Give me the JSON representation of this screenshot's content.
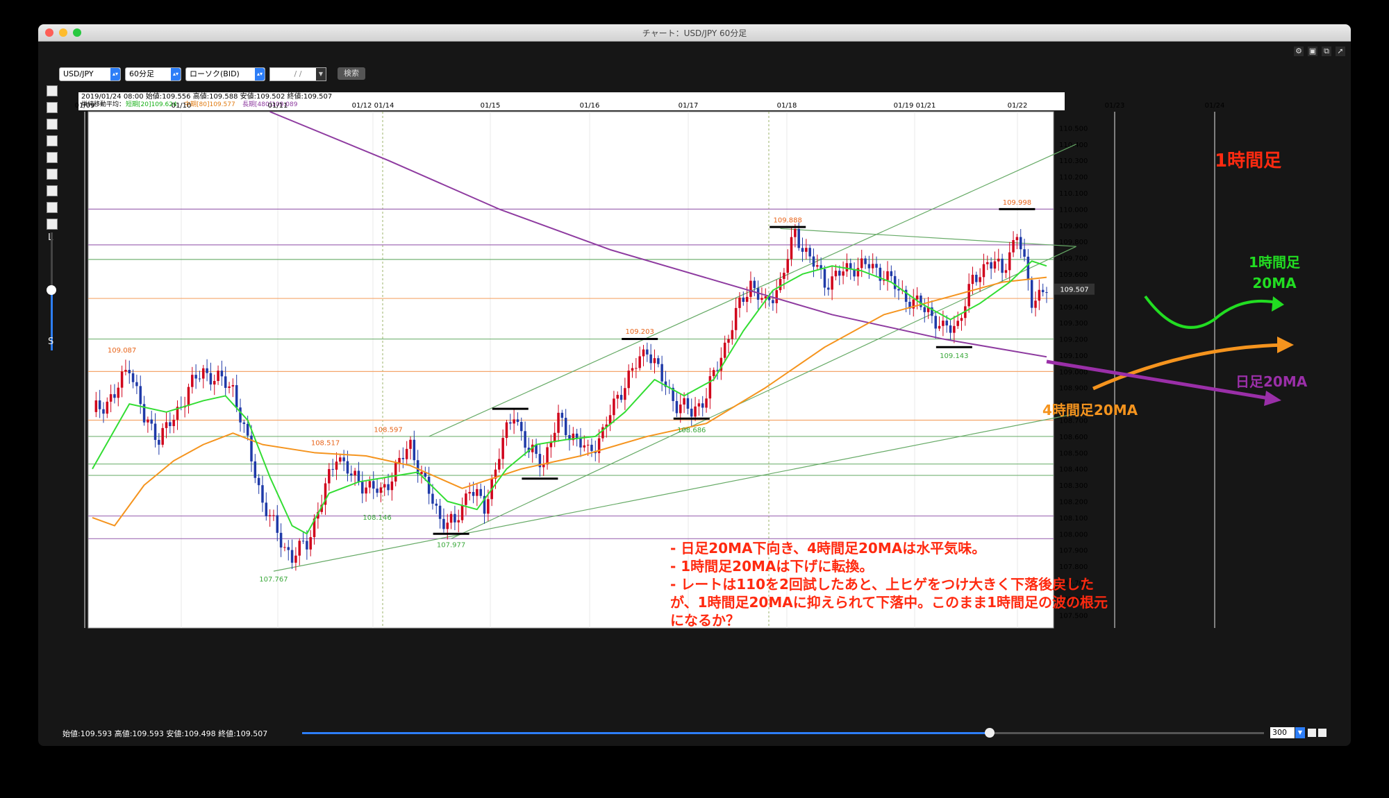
{
  "window": {
    "title": "チャート：USD/JPY 60分足"
  },
  "toolbar": {
    "symbol": "USD/JPY",
    "timeframe": "60分足",
    "chart_type": "ローソク(BID)",
    "date_placeholder": "/ /",
    "search_label": "検索"
  },
  "left_tools": {
    "zoom_large": "L",
    "zoom_small": "S"
  },
  "info": {
    "ohlc_line": "2019/01/24 08:00 始値:109.556 高値:109.588 安値:109.502 終値:109.507",
    "ma_prefix": "単純移動平均：",
    "ma_short": "短期[20]109.624",
    "ma_mid": "中期[80]109.577",
    "ma_long": "長期[480]109.089"
  },
  "bottom": {
    "ohlc": "始値:109.593 高値:109.593 安値:109.498 終値:109.507",
    "count": "300"
  },
  "colors": {
    "bull": "#d0021b",
    "bear": "#1f3aa8",
    "ma_short": "#33dd33",
    "ma_mid": "#f5941e",
    "ma_long": "#8e3ba0",
    "annotation_red": "#ff2a10",
    "annotation_green": "#22dd22",
    "annotation_orange": "#f5941e",
    "annotation_purple": "#9a2fa8"
  },
  "chart_data": {
    "type": "candlestick",
    "timeframe": "60分足",
    "x_labels": [
      "01/09",
      "01/10",
      "01/11",
      "01/12 01/14",
      "01/15",
      "01/16",
      "01/17",
      "01/18",
      "01/19 01/21",
      "01/22",
      "01/23",
      "01/24"
    ],
    "y_ticks": [
      "110.500",
      "110.400",
      "110.300",
      "110.200",
      "110.100",
      "110.000",
      "109.900",
      "109.800",
      "109.700",
      "109.600",
      "109.500",
      "109.400",
      "109.300",
      "109.200",
      "109.100",
      "109.000",
      "108.900",
      "108.800",
      "108.700",
      "108.600",
      "108.500",
      "108.400",
      "108.300",
      "108.200",
      "108.100",
      "108.000",
      "107.900",
      "107.800",
      "107.700",
      "107.600",
      "107.500"
    ],
    "ylim": [
      107.42,
      110.6
    ],
    "current_price": "109.507",
    "price_path": [
      [
        0,
        108.75
      ],
      [
        6,
        108.85
      ],
      [
        10,
        109.05
      ],
      [
        14,
        108.7
      ],
      [
        18,
        108.6
      ],
      [
        22,
        108.7
      ],
      [
        26,
        108.9
      ],
      [
        30,
        109.0
      ],
      [
        34,
        108.95
      ],
      [
        38,
        108.9
      ],
      [
        42,
        108.55
      ],
      [
        46,
        108.2
      ],
      [
        50,
        108.0
      ],
      [
        54,
        107.85
      ],
      [
        58,
        107.95
      ],
      [
        62,
        108.2
      ],
      [
        66,
        108.5
      ],
      [
        70,
        108.35
      ],
      [
        74,
        108.3
      ],
      [
        78,
        108.25
      ],
      [
        82,
        108.4
      ],
      [
        86,
        108.55
      ],
      [
        90,
        108.3
      ],
      [
        94,
        108.1
      ],
      [
        98,
        108.05
      ],
      [
        102,
        108.3
      ],
      [
        106,
        108.15
      ],
      [
        110,
        108.5
      ],
      [
        114,
        108.75
      ],
      [
        118,
        108.5
      ],
      [
        122,
        108.45
      ],
      [
        126,
        108.7
      ],
      [
        130,
        108.6
      ],
      [
        134,
        108.5
      ],
      [
        138,
        108.62
      ],
      [
        142,
        108.85
      ],
      [
        146,
        109.0
      ],
      [
        150,
        109.15
      ],
      [
        154,
        108.95
      ],
      [
        158,
        108.8
      ],
      [
        162,
        108.75
      ],
      [
        166,
        108.85
      ],
      [
        170,
        109.1
      ],
      [
        174,
        109.35
      ],
      [
        178,
        109.55
      ],
      [
        182,
        109.4
      ],
      [
        186,
        109.55
      ],
      [
        190,
        109.85
      ],
      [
        194,
        109.7
      ],
      [
        198,
        109.55
      ],
      [
        202,
        109.6
      ],
      [
        206,
        109.65
      ],
      [
        210,
        109.65
      ],
      [
        214,
        109.6
      ],
      [
        218,
        109.5
      ],
      [
        222,
        109.42
      ],
      [
        226,
        109.38
      ],
      [
        230,
        109.25
      ],
      [
        234,
        109.3
      ],
      [
        238,
        109.55
      ],
      [
        242,
        109.68
      ],
      [
        246,
        109.62
      ],
      [
        250,
        109.85
      ],
      [
        254,
        109.45
      ],
      [
        258,
        109.5
      ]
    ],
    "ma_short_path": [
      [
        0,
        108.4
      ],
      [
        10,
        108.8
      ],
      [
        20,
        108.75
      ],
      [
        30,
        108.82
      ],
      [
        36,
        108.85
      ],
      [
        42,
        108.7
      ],
      [
        48,
        108.35
      ],
      [
        54,
        108.05
      ],
      [
        58,
        108.0
      ],
      [
        64,
        108.25
      ],
      [
        72,
        108.32
      ],
      [
        80,
        108.35
      ],
      [
        88,
        108.38
      ],
      [
        96,
        108.2
      ],
      [
        104,
        108.15
      ],
      [
        112,
        108.4
      ],
      [
        120,
        108.55
      ],
      [
        128,
        108.58
      ],
      [
        136,
        108.6
      ],
      [
        144,
        108.75
      ],
      [
        152,
        108.95
      ],
      [
        160,
        108.85
      ],
      [
        168,
        108.95
      ],
      [
        176,
        109.25
      ],
      [
        184,
        109.5
      ],
      [
        192,
        109.6
      ],
      [
        200,
        109.65
      ],
      [
        208,
        109.62
      ],
      [
        216,
        109.55
      ],
      [
        224,
        109.42
      ],
      [
        232,
        109.32
      ],
      [
        240,
        109.42
      ],
      [
        248,
        109.55
      ],
      [
        254,
        109.68
      ],
      [
        258,
        109.65
      ]
    ],
    "ma_mid_path": [
      [
        0,
        108.1
      ],
      [
        6,
        108.05
      ],
      [
        14,
        108.3
      ],
      [
        22,
        108.45
      ],
      [
        30,
        108.55
      ],
      [
        38,
        108.62
      ],
      [
        46,
        108.55
      ],
      [
        60,
        108.5
      ],
      [
        74,
        108.48
      ],
      [
        86,
        108.42
      ],
      [
        100,
        108.28
      ],
      [
        116,
        108.4
      ],
      [
        132,
        108.48
      ],
      [
        150,
        108.6
      ],
      [
        166,
        108.68
      ],
      [
        182,
        108.9
      ],
      [
        198,
        109.15
      ],
      [
        214,
        109.35
      ],
      [
        230,
        109.45
      ],
      [
        246,
        109.55
      ],
      [
        258,
        109.58
      ]
    ],
    "ma_long_path": [
      [
        48,
        110.6
      ],
      [
        80,
        110.3
      ],
      [
        110,
        110.0
      ],
      [
        140,
        109.75
      ],
      [
        170,
        109.55
      ],
      [
        200,
        109.35
      ],
      [
        230,
        109.2
      ],
      [
        258,
        109.09
      ]
    ],
    "horizontal_lines": [
      {
        "value": 110.0,
        "color": "purple"
      },
      {
        "value": 109.78,
        "color": "purple"
      },
      {
        "value": 109.69,
        "color": "green"
      },
      {
        "value": 109.45,
        "color": "orange"
      },
      {
        "value": 109.2,
        "color": "green"
      },
      {
        "value": 109.0,
        "color": "orange"
      },
      {
        "value": 108.7,
        "color": "orange"
      },
      {
        "value": 108.6,
        "color": "green"
      },
      {
        "value": 108.43,
        "color": "green"
      },
      {
        "value": 108.36,
        "color": "green"
      },
      {
        "value": 108.11,
        "color": "purple"
      },
      {
        "value": 107.97,
        "color": "purple"
      }
    ],
    "trendlines": [
      {
        "from": [
          49,
          107.77
        ],
        "to": [
          266,
          108.74
        ]
      },
      {
        "from": [
          97,
          107.97
        ],
        "to": [
          266,
          109.77
        ]
      },
      {
        "from": [
          91,
          108.6
        ],
        "to": [
          266,
          110.4
        ]
      },
      {
        "from": [
          186,
          109.88
        ],
        "to": [
          266,
          109.77
        ]
      }
    ],
    "markers": [
      {
        "label": "109.087",
        "kind": "high",
        "x": 8,
        "value": 109.087
      },
      {
        "label": "107.767",
        "kind": "low",
        "x": 49,
        "value": 107.767
      },
      {
        "label": "108.517",
        "kind": "high",
        "x": 63,
        "value": 108.517
      },
      {
        "label": "108.146",
        "kind": "low",
        "x": 77,
        "value": 108.146
      },
      {
        "label": "108.597",
        "kind": "high",
        "x": 80,
        "value": 108.597
      },
      {
        "label": "107.977",
        "kind": "low",
        "x": 97,
        "value": 107.977
      },
      {
        "label": "109.203",
        "kind": "high",
        "x": 148,
        "value": 109.203
      },
      {
        "label": "108.686",
        "kind": "low",
        "x": 162,
        "value": 108.686
      },
      {
        "label": "109.888",
        "kind": "high",
        "x": 188,
        "value": 109.888
      },
      {
        "label": "109.143",
        "kind": "low",
        "x": 233,
        "value": 109.143
      },
      {
        "label": "109.998",
        "kind": "high",
        "x": 250,
        "value": 109.998
      }
    ],
    "bar_marks": [
      {
        "x": 97,
        "value": 108.0
      },
      {
        "x": 113,
        "value": 108.77
      },
      {
        "x": 121,
        "value": 108.34
      },
      {
        "x": 148,
        "value": 109.2
      },
      {
        "x": 162,
        "value": 108.71
      },
      {
        "x": 188,
        "value": 109.89
      },
      {
        "x": 233,
        "value": 109.15
      },
      {
        "x": 250,
        "value": 110.0
      }
    ],
    "annotations": {
      "title": "1時間足",
      "label_1h_ma_line1": "1時間足",
      "label_1h_ma_line2": "20MA",
      "label_daily_ma": "日足20MA",
      "label_4h_ma": "4時間足20MA",
      "notes": [
        "- 日足20MA下向き、4時間足20MAは水平気味。",
        "- 1時間足20MAは下げに転換。",
        "- レートは110を2回試したあと、上ヒゲをつけ大きく下落後戻した",
        "が、1時間足20MAに抑えられて下落中。このまま1時間足の波の根元",
        "になるか？"
      ]
    }
  }
}
